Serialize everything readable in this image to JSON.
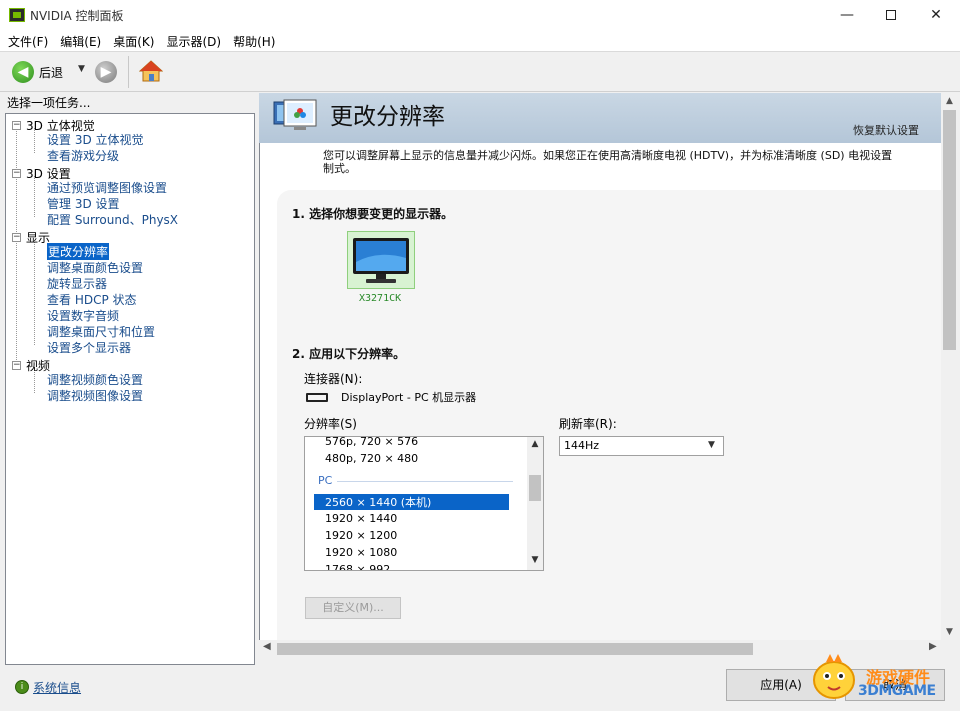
{
  "window": {
    "title": "NVIDIA 控制面板"
  },
  "menu": [
    "文件(F)",
    "编辑(E)",
    "桌面(K)",
    "显示器(D)",
    "帮助(H)"
  ],
  "toolbar": {
    "back_label": "后退"
  },
  "left": {
    "task_label": "选择一项任务...",
    "categories": [
      {
        "label": "3D 立体视觉",
        "items": [
          "设置 3D 立体视觉",
          "查看游戏分级"
        ]
      },
      {
        "label": "3D 设置",
        "items": [
          "通过预览调整图像设置",
          "管理 3D 设置",
          "配置 Surround、PhysX"
        ]
      },
      {
        "label": "显示",
        "items": [
          "更改分辨率",
          "调整桌面颜色设置",
          "旋转显示器",
          "查看 HDCP 状态",
          "设置数字音频",
          "调整桌面尺寸和位置",
          "设置多个显示器"
        ]
      },
      {
        "label": "视频",
        "items": [
          "调整视频颜色设置",
          "调整视频图像设置"
        ]
      }
    ],
    "system_info": "系统信息"
  },
  "main": {
    "title": "更改分辨率",
    "restore_defaults": "恢复默认设置",
    "description": "您可以调整屏幕上显示的信息量并减少闪烁。如果您正在使用高清晰度电视 (HDTV)，并为标准清晰度 (SD) 电视设置\n制式。",
    "step1": "1.  选择你想要变更的显示器。",
    "monitor_name": "X3271CK",
    "step2": "2.  应用以下分辨率。",
    "connector_label": "连接器(N):",
    "connector_value": "DisplayPort - PC 机显示器",
    "resolution_label": "分辨率(S)",
    "refresh_label": "刷新率(R):",
    "resolutions_top": [
      "576p, 720 × 576",
      "480p, 720 × 480"
    ],
    "resolution_group": "PC",
    "resolutions_pc": [
      "2560 × 1440 (本机)",
      "1920 × 1440",
      "1920 × 1200",
      "1920 × 1080",
      "1768 × 992"
    ],
    "refresh_value": "144Hz",
    "custom_button": "自定义(M)..."
  },
  "buttons": {
    "apply": "应用(A)",
    "cancel": "取消"
  },
  "watermark": {
    "line1": "游戏硬件",
    "line2": "3DMGAME"
  }
}
